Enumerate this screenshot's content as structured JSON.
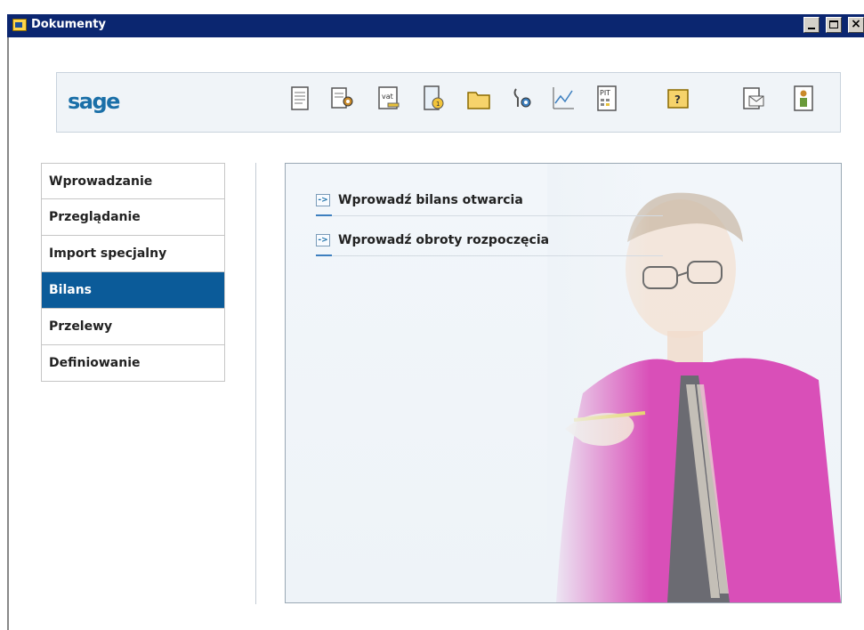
{
  "window": {
    "title": "Dokumenty"
  },
  "toolbar": {
    "logo": "sage",
    "icons": [
      {
        "name": "document-list-icon"
      },
      {
        "name": "document-settings-icon"
      },
      {
        "name": "vat-register-icon",
        "text": "vat"
      },
      {
        "name": "document-timer-icon"
      },
      {
        "name": "folder-icon"
      },
      {
        "name": "tools-settings-icon"
      },
      {
        "name": "chart-icon"
      },
      {
        "name": "pit-calculator-icon",
        "text": "PIT"
      },
      {
        "name": "help-icon",
        "text": "?"
      },
      {
        "name": "mail-icon"
      },
      {
        "name": "person-info-icon"
      }
    ]
  },
  "sidebar": {
    "items": [
      {
        "label": "Wprowadzanie"
      },
      {
        "label": "Przeglądanie"
      },
      {
        "label": "Import specjalny"
      },
      {
        "label": "Bilans",
        "active": true
      },
      {
        "label": "Przelewy"
      },
      {
        "label": "Definiowanie"
      }
    ]
  },
  "main": {
    "actions": [
      {
        "label": "Wprowadź bilans otwarcia",
        "arrow": "->"
      },
      {
        "label": "Wprowadź obroty rozpoczęcia",
        "arrow": "->"
      }
    ]
  },
  "colors": {
    "titlebar": "#0b2670",
    "active_nav": "#0b5b99",
    "accent": "#1a6fa8",
    "shirt": "#d94fb8"
  }
}
